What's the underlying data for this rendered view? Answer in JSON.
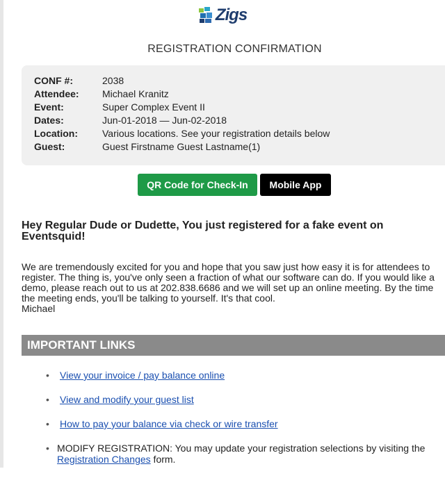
{
  "logo": {
    "text": "Zigs"
  },
  "header": {
    "title": "REGISTRATION CONFIRMATION"
  },
  "confirmation": {
    "rows": [
      {
        "label": "CONF #:",
        "value": "2038"
      },
      {
        "label": "Attendee:",
        "value": "Michael Kranitz"
      },
      {
        "label": "Event:",
        "value": "Super Complex Event II"
      },
      {
        "label": "Dates:",
        "value": "Jun-01-2018 — Jun-02-2018"
      },
      {
        "label": "Location:",
        "value": "Various locations. See your registration details below"
      },
      {
        "label": "Guest:",
        "value": "Guest Firstname Guest Lastname(1)"
      }
    ]
  },
  "buttons": {
    "qr_label": "QR Code for Check-In",
    "app_label": "Mobile App",
    "qr_color": "#1e9a47",
    "app_color": "#000000"
  },
  "message": {
    "greeting": "Hey Regular Dude or Dudette, You just registered for a fake event on Eventsquid!",
    "body": "We are tremendously excited for you and hope that you saw just how easy it is for attendees to register. The thing is, you've only seen a fraction of what our software can do. If you would like a demo, please reach out to us at 202.838.6686 and we will set up an online meeting. By the time the meeting ends, you'll be talking to yourself. It's that cool.",
    "signature": "Michael"
  },
  "links_section": {
    "header": "IMPORTANT LINKS",
    "items": [
      {
        "text": "View your invoice / pay balance online"
      },
      {
        "text": "View and modify your guest list"
      },
      {
        "text": "How to pay your balance via check or wire transfer"
      }
    ],
    "modify": {
      "prefix": "MODIFY REGISTRATION: You may update your registration selections by visiting the ",
      "link": "Registration Changes",
      "suffix": " form."
    }
  }
}
